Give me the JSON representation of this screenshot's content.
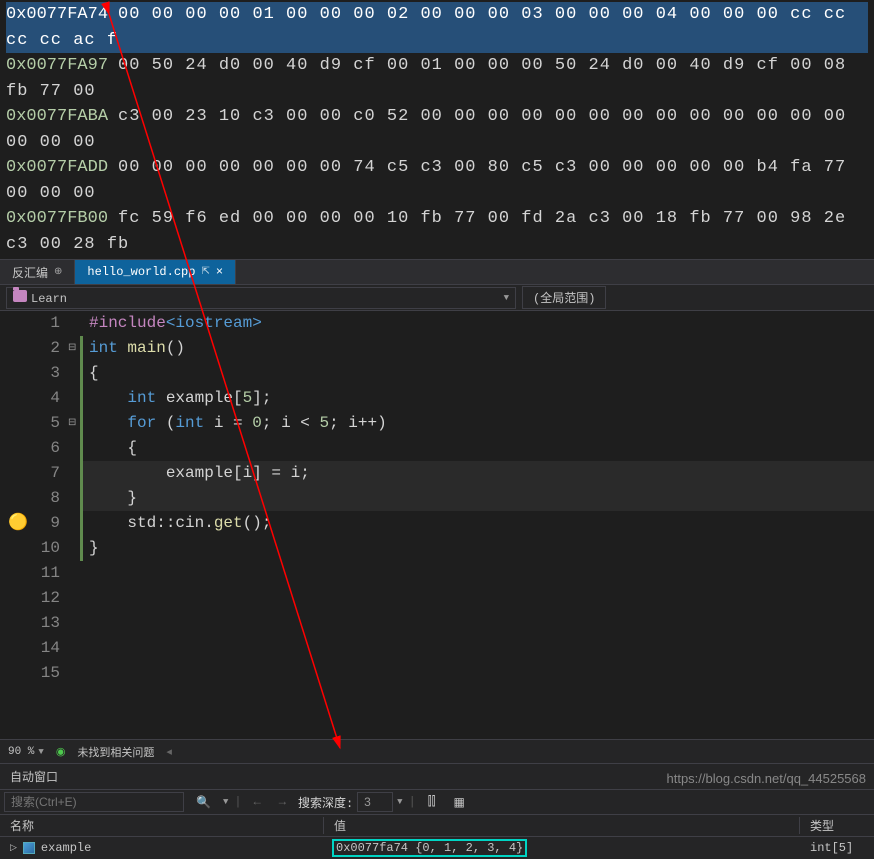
{
  "memory": {
    "rows": [
      {
        "addr": "0x0077FA74",
        "hex": "00 00 00 00 01 00 00 00 02 00 00 00 03 00 00 00 04 00 00 00 cc cc cc cc ac f",
        "sel": true
      },
      {
        "addr": "0x0077FA97",
        "hex": "00 50 24 d0 00 40 d9 cf 00 01 00 00 00 50 24 d0 00 40 d9 cf 00 08 fb 77 00"
      },
      {
        "addr": "0x0077FABA",
        "hex": "c3 00 23 10 c3 00 00 c0 52 00 00 00 00 00 00 00 00 00 00 00 00 00 00 00 00"
      },
      {
        "addr": "0x0077FADD",
        "hex": "00 00 00 00 00 00 00 74 c5 c3 00 80 c5 c3 00 00 00 00 00 b4 fa 77 00 00 00"
      },
      {
        "addr": "0x0077FB00",
        "hex": "fc 59 f6 ed 00 00 00 00 10 fb 77 00 fd 2a c3 00 18 fb 77 00 98 2e c3 00 28 fb"
      }
    ]
  },
  "tabs": {
    "back": "反汇编",
    "active": "hello_world.cpp"
  },
  "scope": {
    "project": "Learn",
    "global": "(全局范围)"
  },
  "code": {
    "lines": [
      {
        "n": 1,
        "html": "<span class='pp'>#include</span><span class='inc'>&lt;iostream&gt;</span>"
      },
      {
        "n": 2,
        "html": "",
        "lg": true
      },
      {
        "n": 3,
        "html": "<span class='kw'>int</span> <span class='fn'>main</span>()",
        "lg": true,
        "fold": true
      },
      {
        "n": 4,
        "html": "{",
        "lg": true
      },
      {
        "n": 5,
        "html": "    <span class='kw'>int</span> example[<span class='num'>5</span>];",
        "lg": true
      },
      {
        "n": 6,
        "html": "",
        "lg": true
      },
      {
        "n": 7,
        "html": "    <span class='kw'>for</span> (<span class='kw'>int</span> i = <span class='num'>0</span>; i &lt; <span class='num'>5</span>; i++)",
        "lg": true,
        "fold": true
      },
      {
        "n": 8,
        "html": "    {",
        "lg": true
      },
      {
        "n": 9,
        "html": "        example[i] = i;",
        "lg": true,
        "hl": true
      },
      {
        "n": 10,
        "html": "    }",
        "lg": true,
        "hl": true
      },
      {
        "n": 11,
        "html": "",
        "lg": true
      },
      {
        "n": 12,
        "html": "    std::cin.<span class='fn'>get</span>();",
        "lg": true,
        "brk": true
      },
      {
        "n": 13,
        "html": "}",
        "lg": true
      },
      {
        "n": 14,
        "html": ""
      },
      {
        "n": 15,
        "html": ""
      }
    ]
  },
  "status": {
    "zoom": "90 %",
    "msg": "未找到相关问题"
  },
  "auto": {
    "title": "自动窗口",
    "search_ph": "搜索(Ctrl+E)",
    "depth_label": "搜索深度:",
    "depth_val": "3",
    "col_name": "名称",
    "col_value": "值",
    "col_type": "类型",
    "row": {
      "name": "example",
      "value": "0x0077fa74 {0, 1, 2, 3, 4}",
      "type": "int[5]"
    }
  },
  "watermark": "https://blog.csdn.net/qq_44525568"
}
